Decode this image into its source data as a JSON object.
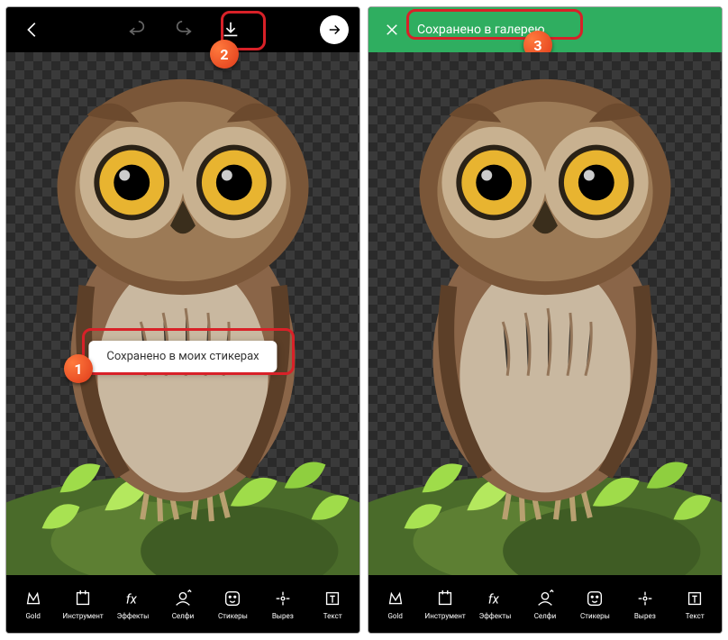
{
  "left": {
    "toast": "Сохранено в моих стикерах",
    "tools": [
      "Gold",
      "Инструмент",
      "Эффекты",
      "Селфи",
      "Стикеры",
      "Вырез",
      "Текст"
    ]
  },
  "right": {
    "banner": "Сохранено в галерею",
    "tools": [
      "Gold",
      "Инструмент",
      "Эффекты",
      "Селфи",
      "Стикеры",
      "Вырез",
      "Текст"
    ]
  },
  "badges": {
    "one": "1",
    "two": "2",
    "three": "3"
  }
}
